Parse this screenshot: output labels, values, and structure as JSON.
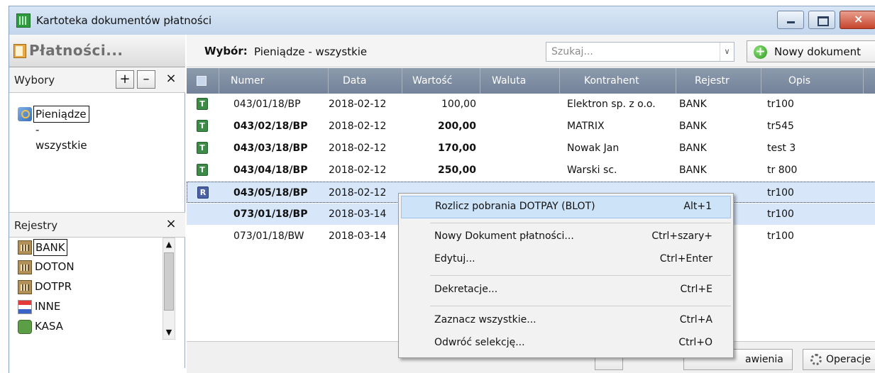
{
  "window": {
    "title": "Kartoteka dokumentów płatności"
  },
  "left": {
    "title": "Płatności...",
    "wybory": {
      "label": "Wybory",
      "add": "+",
      "remove": "–",
      "close": "×",
      "items": [
        "Pieniądze - wszystkie"
      ]
    },
    "rejestry": {
      "label": "Rejestry",
      "close": "×",
      "items": [
        "BANK",
        "DOTON",
        "DOTPR",
        "INNE",
        "KASA"
      ]
    },
    "scroll_up": "▲",
    "scroll_down": "▼"
  },
  "toolbar": {
    "wybor_label": "Wybór:",
    "wybor_value": "Pieniądze - wszystkie",
    "search_placeholder": "Szukaj...",
    "search_dropdown": "∨",
    "new_doc": "Nowy dokument",
    "new_doc_plus": "+"
  },
  "table": {
    "columns": [
      "Numer",
      "Data",
      "Wartość",
      "Waluta",
      "Kontrahent",
      "Rejestr",
      "Opis"
    ],
    "rows": [
      {
        "badge": "T",
        "numer": "043/01/18/BP",
        "data": "2018-02-12",
        "wartosc": "100,00",
        "waluta": "",
        "kontrahent": "Elektron sp. z o.o.",
        "rejestr": "BANK",
        "opis": "tr100"
      },
      {
        "badge": "T",
        "numer": "043/02/18/BP",
        "data": "2018-02-12",
        "wartosc": "200,00",
        "waluta": "",
        "kontrahent": "MATRIX",
        "rejestr": "BANK",
        "opis": "tr545"
      },
      {
        "badge": "T",
        "numer": "043/03/18/BP",
        "data": "2018-02-12",
        "wartosc": "170,00",
        "waluta": "",
        "kontrahent": "Nowak Jan",
        "rejestr": "BANK",
        "opis": "test 3"
      },
      {
        "badge": "T",
        "numer": "043/04/18/BP",
        "data": "2018-02-12",
        "wartosc": "250,00",
        "waluta": "",
        "kontrahent": "Warski sc.",
        "rejestr": "BANK",
        "opis": "tr 800"
      },
      {
        "badge": "R",
        "numer": "043/05/18/BP",
        "data": "2018-02-12",
        "wartosc": "",
        "waluta": "",
        "kontrahent": "",
        "rejestr": "",
        "opis": "tr100"
      },
      {
        "badge": "",
        "numer": "073/01/18/BP",
        "data": "2018-03-14",
        "wartosc": "",
        "waluta": "",
        "kontrahent": "",
        "rejestr": "",
        "opis": "tr100"
      },
      {
        "badge": "",
        "numer": "073/01/18/BW",
        "data": "2018-03-14",
        "wartosc": "",
        "waluta": "",
        "kontrahent": "",
        "rejestr": "",
        "opis": "tr100"
      }
    ]
  },
  "context_menu": {
    "items": [
      {
        "label": "Rozlicz pobrania DOTPAY (BLOT)",
        "shortcut": "Alt+1"
      },
      {
        "label": "Nowy Dokument płatności...",
        "shortcut": "Ctrl+szary+"
      },
      {
        "label": "Edytuj...",
        "shortcut": "Ctrl+Enter"
      },
      {
        "label": "Dekretacje...",
        "shortcut": "Ctrl+E"
      },
      {
        "label": "Zaznacz wszystkie...",
        "shortcut": "Ctrl+A"
      },
      {
        "label": "Odwróć selekcję...",
        "shortcut": "Ctrl+O"
      }
    ]
  },
  "bottom": {
    "ustawienia": "awienia",
    "operacje": "Operacje"
  },
  "colors": {
    "header": "#7f8ea3",
    "selection": "#d7e6f8",
    "menu_highlight": "#cde3f8"
  }
}
